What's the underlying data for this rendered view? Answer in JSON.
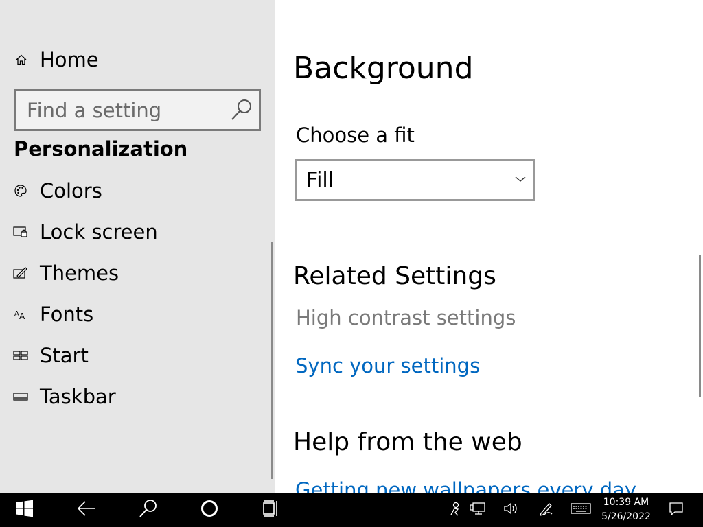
{
  "sidebar": {
    "home_label": "Home",
    "search": {
      "placeholder": "Find a setting"
    },
    "section_title": "Personalization",
    "items": [
      {
        "label": "Colors",
        "icon": "palette-icon"
      },
      {
        "label": "Lock screen",
        "icon": "lock-screen-icon"
      },
      {
        "label": "Themes",
        "icon": "themes-icon"
      },
      {
        "label": "Fonts",
        "icon": "fonts-icon"
      },
      {
        "label": "Start",
        "icon": "start-icon"
      },
      {
        "label": "Taskbar",
        "icon": "taskbar-icon"
      }
    ]
  },
  "main": {
    "title": "Background",
    "fit_label": "Choose a fit",
    "fit_value": "Fill",
    "related_title": "Related Settings",
    "high_contrast_label": "High contrast settings",
    "sync_label": "Sync your settings",
    "help_title": "Help from the web",
    "wallpaper_link": "Getting new wallpapers every day"
  },
  "taskbar": {
    "time": "10:39 AM",
    "date": "5/26/2022"
  },
  "colors": {
    "link": "#0067c0",
    "sidebar_bg": "#e6e6e6",
    "taskbar_bg": "#000000"
  }
}
